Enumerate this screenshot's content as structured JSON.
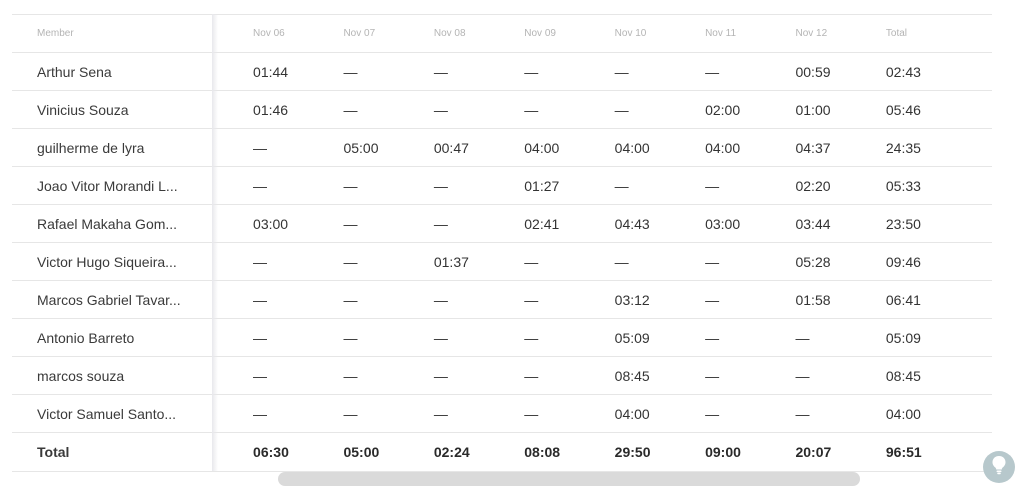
{
  "table": {
    "headers": {
      "member": "Member",
      "days": [
        "Nov 06",
        "Nov 07",
        "Nov 08",
        "Nov 09",
        "Nov 10",
        "Nov 11",
        "Nov 12"
      ],
      "total": "Total"
    },
    "rows": [
      {
        "member": "Arthur Sena",
        "days": [
          "01:44",
          "—",
          "—",
          "—",
          "—",
          "—",
          "00:59"
        ],
        "total": "02:43"
      },
      {
        "member": "Vinicius Souza",
        "days": [
          "01:46",
          "—",
          "—",
          "—",
          "—",
          "02:00",
          "01:00"
        ],
        "total": "05:46"
      },
      {
        "member": "guilherme de lyra",
        "days": [
          "—",
          "05:00",
          "00:47",
          "04:00",
          "04:00",
          "04:00",
          "04:37"
        ],
        "total": "24:35"
      },
      {
        "member": "Joao Vitor Morandi L...",
        "days": [
          "—",
          "—",
          "—",
          "01:27",
          "—",
          "—",
          "02:20"
        ],
        "total": "05:33"
      },
      {
        "member": "Rafael Makaha Gom...",
        "days": [
          "03:00",
          "—",
          "—",
          "02:41",
          "04:43",
          "03:00",
          "03:44"
        ],
        "total": "23:50"
      },
      {
        "member": "Victor Hugo Siqueira...",
        "days": [
          "—",
          "—",
          "01:37",
          "—",
          "—",
          "—",
          "05:28"
        ],
        "total": "09:46"
      },
      {
        "member": "Marcos Gabriel Tavar...",
        "days": [
          "—",
          "—",
          "—",
          "—",
          "03:12",
          "—",
          "01:58"
        ],
        "total": "06:41"
      },
      {
        "member": "Antonio Barreto",
        "days": [
          "—",
          "—",
          "—",
          "—",
          "05:09",
          "—",
          "—"
        ],
        "total": "05:09"
      },
      {
        "member": "marcos souza",
        "days": [
          "—",
          "—",
          "—",
          "—",
          "08:45",
          "—",
          "—"
        ],
        "total": "08:45"
      },
      {
        "member": "Victor Samuel Santo...",
        "days": [
          "—",
          "—",
          "—",
          "—",
          "04:00",
          "—",
          "—"
        ],
        "total": "04:00"
      }
    ],
    "footer": {
      "label": "Total",
      "days": [
        "06:30",
        "05:00",
        "02:24",
        "08:08",
        "29:50",
        "09:00",
        "20:07"
      ],
      "total": "96:51"
    }
  },
  "icons": {
    "help": "lightbulb-icon"
  },
  "colors": {
    "scrollbar": "#dadada",
    "help_button": "#b7c8cc"
  }
}
